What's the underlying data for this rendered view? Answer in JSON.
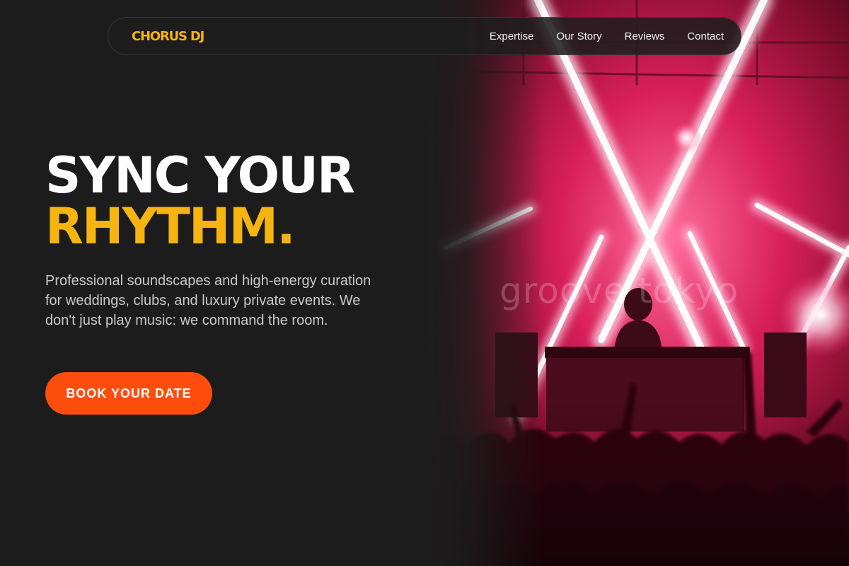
{
  "brand": {
    "name": "CHORUS DJ",
    "color": "#f5b40f"
  },
  "nav": {
    "links": [
      {
        "label": "Expertise"
      },
      {
        "label": "Our Story"
      },
      {
        "label": "Reviews"
      },
      {
        "label": "Contact"
      }
    ]
  },
  "hero": {
    "headline_line1": "SYNC YOUR",
    "headline_line2": "RHYTHM.",
    "description": "Professional soundscapes and high-energy curation for weddings, clubs, and luxury private events. We don't just play music: we command the room.",
    "cta_label": "BOOK YOUR DATE",
    "photo_watermark": "groove tokyo"
  },
  "colors": {
    "background": "#1c1c1c",
    "accent": "#f5b40f",
    "cta": "#ff4d0d"
  }
}
